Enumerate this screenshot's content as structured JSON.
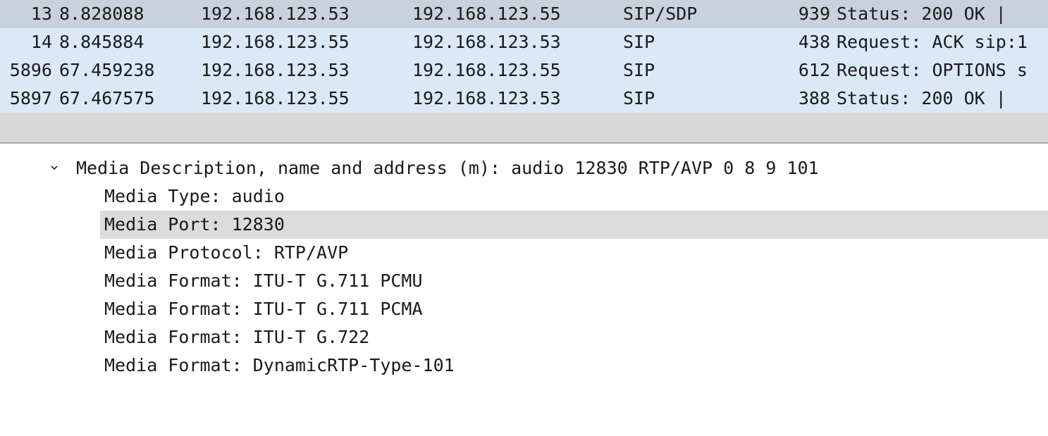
{
  "packet_list": {
    "rows": [
      {
        "no": "13",
        "time": "8.828088",
        "source": "192.168.123.53",
        "destination": "192.168.123.55",
        "protocol": "SIP/SDP",
        "length": "939",
        "info": "Status: 200 OK |",
        "selected": true
      },
      {
        "no": "14",
        "time": "8.845884",
        "source": "192.168.123.55",
        "destination": "192.168.123.53",
        "protocol": "SIP",
        "length": "438",
        "info": "Request: ACK sip:1",
        "selected": false
      },
      {
        "no": "5896",
        "time": "67.459238",
        "source": "192.168.123.53",
        "destination": "192.168.123.55",
        "protocol": "SIP",
        "length": "612",
        "info": "Request: OPTIONS s",
        "selected": false
      },
      {
        "no": "5897",
        "time": "67.467575",
        "source": "192.168.123.55",
        "destination": "192.168.123.53",
        "protocol": "SIP",
        "length": "388",
        "info": "Status: 200 OK |",
        "selected": false
      }
    ]
  },
  "details": {
    "header": {
      "icon": "chevron-down-icon",
      "label": "Media Description, name and address (m): audio 12830 RTP/AVP 0 8 9 101"
    },
    "fields": [
      {
        "label": "Media Type: audio",
        "highlighted": false
      },
      {
        "label": "Media Port: 12830",
        "highlighted": true
      },
      {
        "label": "Media Protocol: RTP/AVP",
        "highlighted": false
      },
      {
        "label": "Media Format: ITU-T G.711 PCMU",
        "highlighted": false
      },
      {
        "label": "Media Format: ITU-T G.711 PCMA",
        "highlighted": false
      },
      {
        "label": "Media Format: ITU-T G.722",
        "highlighted": false
      },
      {
        "label": "Media Format: DynamicRTP-Type-101",
        "highlighted": false
      }
    ]
  },
  "colors": {
    "row_bg": "#dbe9f7",
    "selected_row_bg": "#c9d2dc",
    "highlight_bg": "#dcdcdc",
    "separator_bg": "#d8d8d8"
  }
}
